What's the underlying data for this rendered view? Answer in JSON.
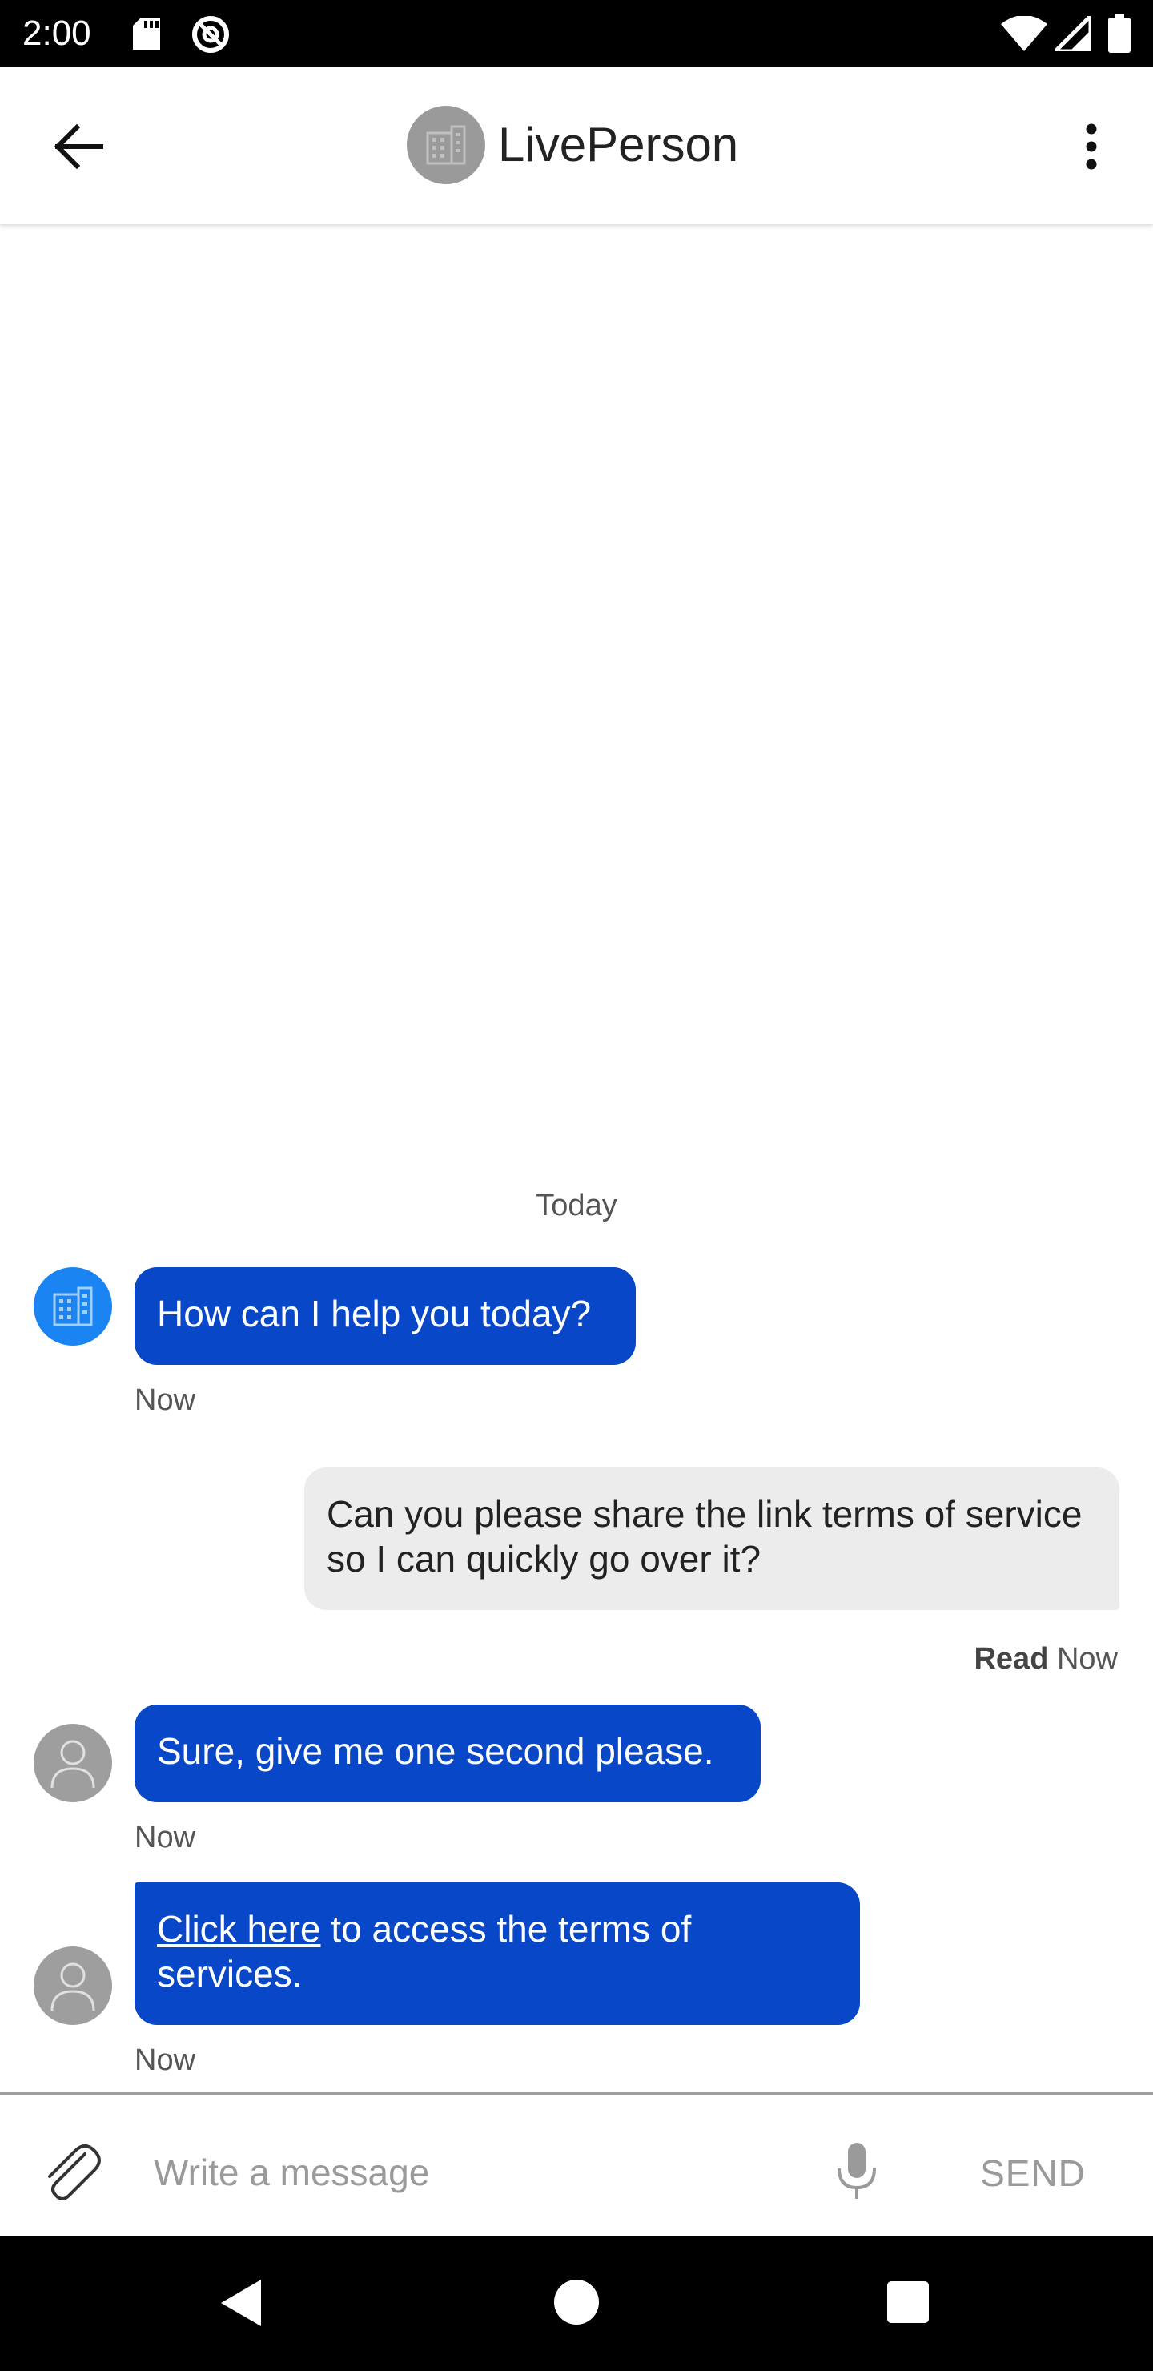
{
  "status_bar": {
    "time": "2:00",
    "icons": [
      "sd-card-icon",
      "do-not-disturb-icon",
      "wifi-icon",
      "signal-icon",
      "battery-icon"
    ]
  },
  "header": {
    "title": "LivePerson",
    "back_icon": "arrow-left-icon",
    "menu_icon": "more-vert-icon",
    "avatar_icon": "building-icon"
  },
  "chat": {
    "date_divider": "Today",
    "messages": [
      {
        "sender": "bot",
        "text": "How can I help you today?",
        "time": "Now"
      },
      {
        "sender": "user",
        "text": "Can you please share the link terms of service so I can quickly go over it?",
        "status": "Read",
        "time": "Now"
      },
      {
        "sender": "agent",
        "text": "Sure, give me one second please.",
        "time": "Now"
      },
      {
        "sender": "agent",
        "link_text": "Click here",
        "text": " to access the terms of services.",
        "time": "Now"
      }
    ]
  },
  "composer": {
    "placeholder": "Write a message",
    "send_label": "SEND"
  },
  "colors": {
    "agent_bubble": "#0747c8",
    "user_bubble": "#ececec",
    "bot_avatar": "#1a84f2",
    "agent_avatar": "#9e9e9e"
  }
}
